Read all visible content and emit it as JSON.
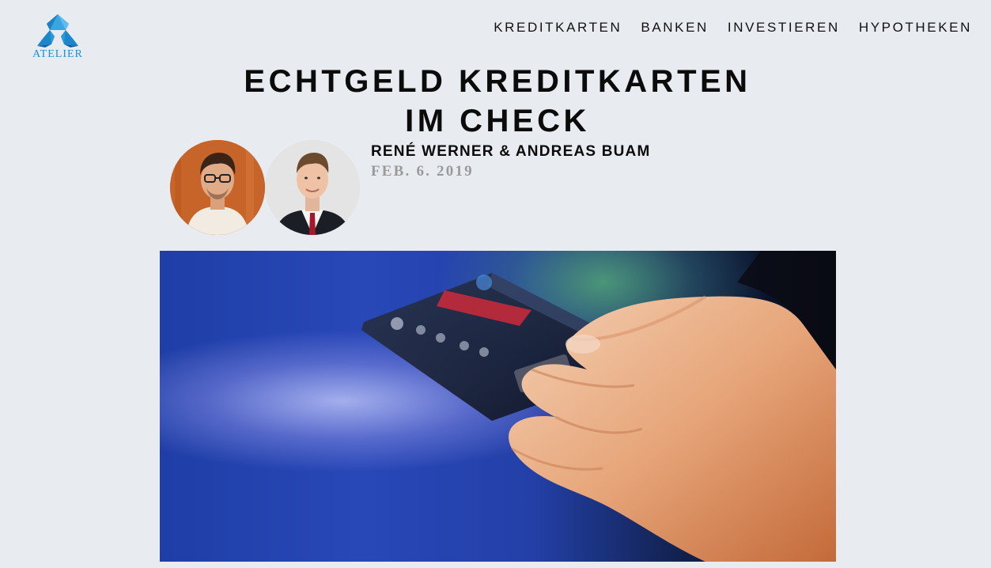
{
  "logo": {
    "text": "ATELIER",
    "icon": "atelier-logo-icon",
    "color": "#1a8fd0"
  },
  "nav": {
    "items": [
      {
        "label": "KREDITKARTEN"
      },
      {
        "label": "BANKEN"
      },
      {
        "label": "INVESTIEREN"
      },
      {
        "label": "HYPOTHEKEN"
      }
    ]
  },
  "article": {
    "title_line1": "ECHTGELD KREDITKARTEN",
    "title_line2": "IM CHECK",
    "authors": "RENÉ WERNER & ANDREAS BUAM",
    "date": "FEB. 6. 2019",
    "date_color": "#9a9a9a"
  },
  "hero": {
    "icon": "hand-holding-credit-card-photo"
  },
  "colors": {
    "background": "#e8ecf0",
    "text": "#0b0b0b"
  }
}
